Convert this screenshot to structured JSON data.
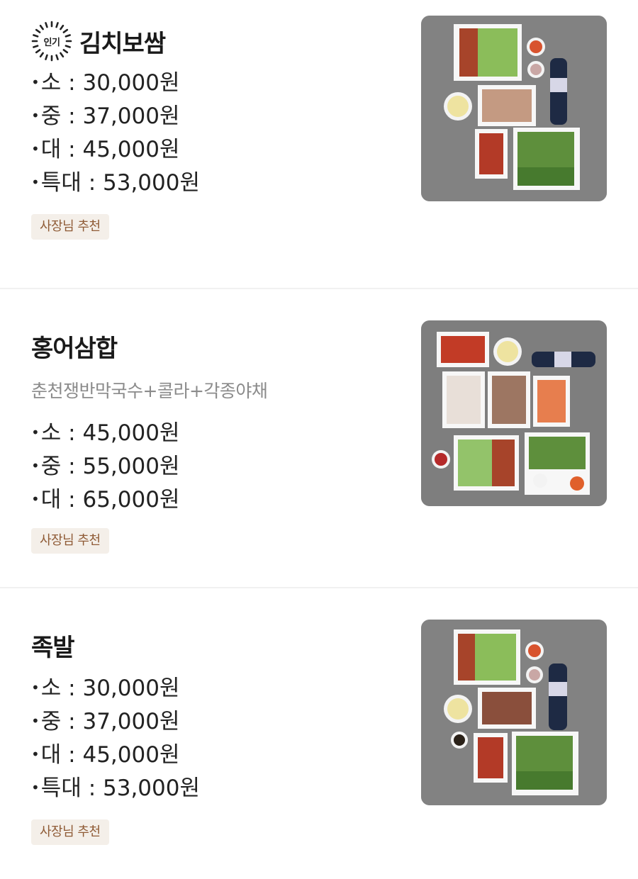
{
  "menu_items": [
    {
      "name": "김치보쌈",
      "badge": "인기",
      "prices": [
        {
          "size": "소",
          "price": "30,000원"
        },
        {
          "size": "중",
          "price": "37,000원"
        },
        {
          "size": "대",
          "price": "45,000원"
        },
        {
          "size": "특대",
          "price": "53,000원"
        }
      ],
      "tag": "사장님 추천",
      "photo_icon": "bossam-platter-photo"
    },
    {
      "name": "홍어삼합",
      "description": "춘천쟁반막국수+콜라+각종야채",
      "prices": [
        {
          "size": "소",
          "price": "45,000원"
        },
        {
          "size": "중",
          "price": "55,000원"
        },
        {
          "size": "대",
          "price": "65,000원"
        }
      ],
      "tag": "사장님 추천",
      "photo_icon": "hongeo-samhap-platter-photo"
    },
    {
      "name": "족발",
      "prices": [
        {
          "size": "소",
          "price": "30,000원"
        },
        {
          "size": "중",
          "price": "37,000원"
        },
        {
          "size": "대",
          "price": "45,000원"
        },
        {
          "size": "특대",
          "price": "53,000원"
        }
      ],
      "tag": "사장님 추천",
      "photo_icon": "jokbal-platter-photo"
    }
  ],
  "separator": " : ",
  "bullet": "•",
  "colors": {
    "tag_bg": "#f4efe9",
    "tag_text": "#8f5b36",
    "description": "#8b8b8b",
    "divider": "#f1f1f1"
  }
}
